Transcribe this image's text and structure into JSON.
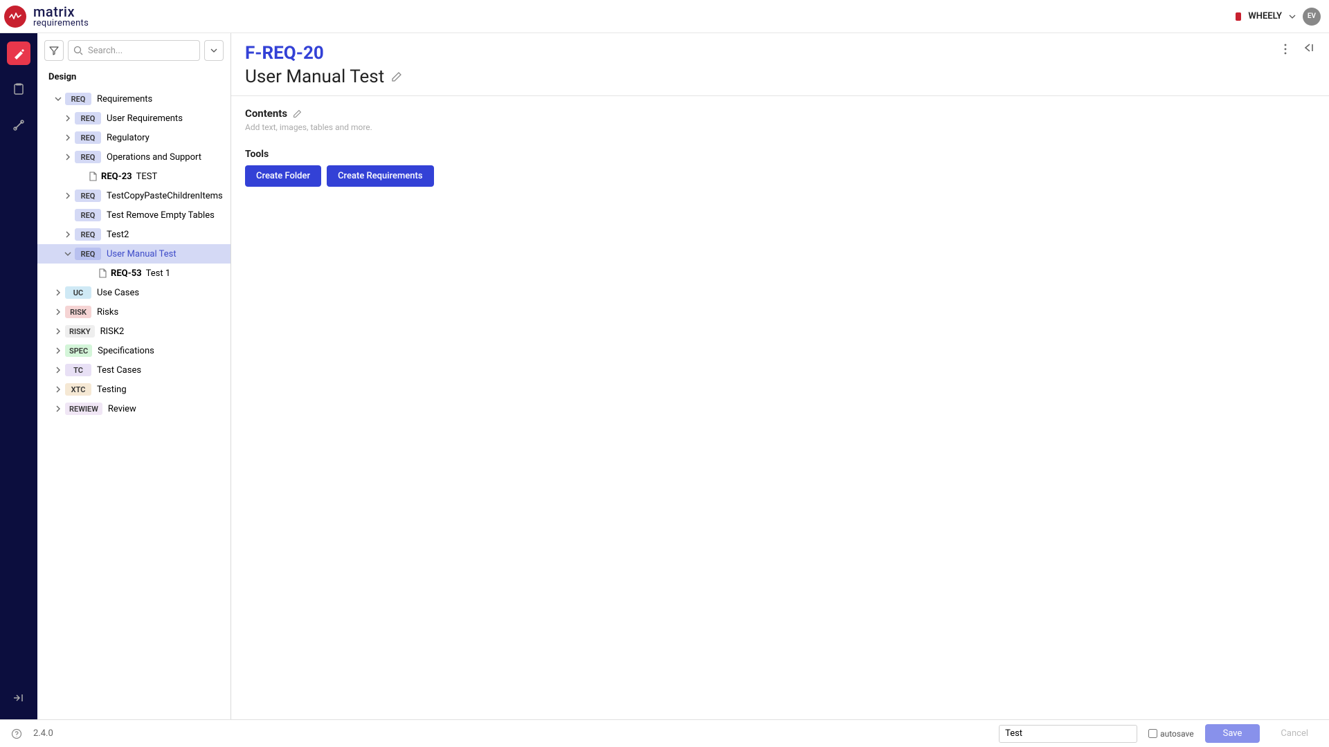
{
  "brand": {
    "top": "matrix",
    "bottom": "requirements"
  },
  "header": {
    "project_label": "WHEELY",
    "avatar_initials": "EV"
  },
  "sidebar": {
    "search_placeholder": "Search...",
    "section_title": "Design"
  },
  "tree": [
    {
      "level": 0,
      "chevron": "down",
      "tag": "REQ",
      "label": "Requirements",
      "selected": false
    },
    {
      "level": 1,
      "chevron": "right",
      "tag": "REQ",
      "label": "User Requirements"
    },
    {
      "level": 1,
      "chevron": "right",
      "tag": "REQ",
      "label": "Regulatory"
    },
    {
      "level": 1,
      "chevron": "right",
      "tag": "REQ",
      "label": "Operations and Support"
    },
    {
      "level": 1,
      "chevron": "",
      "doc": true,
      "doc_id": "REQ-23",
      "label": "TEST"
    },
    {
      "level": 1,
      "chevron": "right",
      "tag": "REQ",
      "label": "TestCopyPasteChildrenItems"
    },
    {
      "level": 1,
      "chevron": "",
      "tag": "REQ",
      "label": "Test Remove Empty Tables"
    },
    {
      "level": 1,
      "chevron": "right",
      "tag": "REQ",
      "label": "Test2"
    },
    {
      "level": 1,
      "chevron": "down",
      "tag": "REQ",
      "label": "User Manual Test",
      "selected": true
    },
    {
      "level": 2,
      "chevron": "",
      "doc": true,
      "doc_id": "REQ-53",
      "label": "Test 1"
    },
    {
      "level": 0,
      "chevron": "right",
      "tag": "UC",
      "label": "Use Cases"
    },
    {
      "level": 0,
      "chevron": "right",
      "tag": "RISK",
      "label": "Risks"
    },
    {
      "level": 0,
      "chevron": "right",
      "tag": "RISKY",
      "label": "RISK2"
    },
    {
      "level": 0,
      "chevron": "right",
      "tag": "SPEC",
      "label": "Specifications"
    },
    {
      "level": 0,
      "chevron": "right",
      "tag": "TC",
      "label": "Test Cases"
    },
    {
      "level": 0,
      "chevron": "right",
      "tag": "XTC",
      "label": "Testing"
    },
    {
      "level": 0,
      "chevron": "right",
      "tag": "REWIEW",
      "label": "Review"
    }
  ],
  "main": {
    "breadcrumb": "F-REQ-20",
    "title": "User Manual Test",
    "contents_label": "Contents",
    "contents_placeholder": "Add text, images, tables and more.",
    "tools_label": "Tools",
    "btn_create_folder": "Create Folder",
    "btn_create_requirements": "Create Requirements"
  },
  "footer": {
    "version": "2.4.0",
    "input_value": "Test",
    "autosave_label": "autosave",
    "save_label": "Save",
    "cancel_label": "Cancel"
  }
}
